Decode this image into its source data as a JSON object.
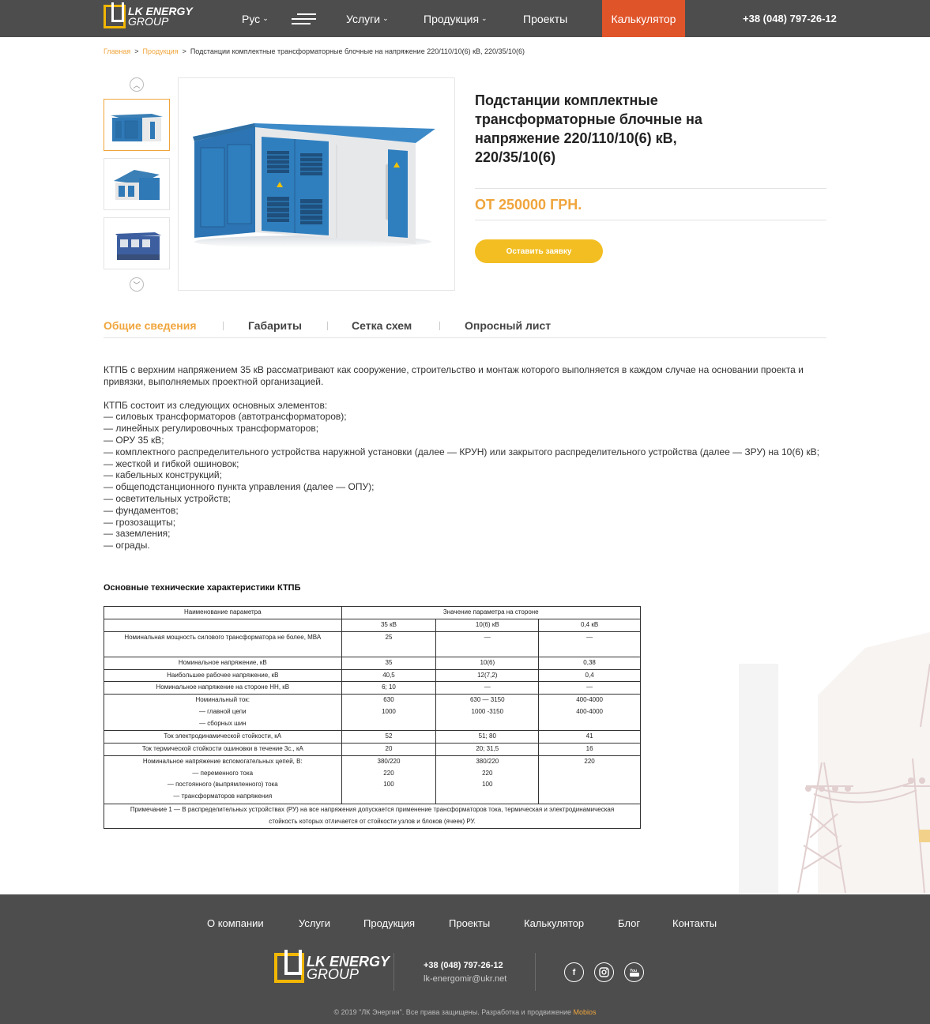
{
  "header": {
    "logo_top": "LK ENERGY",
    "logo_bottom": "GROUP",
    "lang": "Рус",
    "nav_services": "Услуги",
    "nav_products": "Продукция",
    "nav_projects": "Проекты",
    "calculator": "Калькулятор",
    "phone": "+38 (048) 797-26-12"
  },
  "breadcrumb": {
    "home": "Главная",
    "products": "Продукция",
    "current": "Подстанции комплектные трансформаторные блочные на напряжение 220/110/10(6) кВ, 220/35/10(6)",
    "separator": ">"
  },
  "product": {
    "title": "Подстанции комплектные трансформаторные блочные на напряжение 220/110/10(6) кВ, 220/35/10(6)",
    "price": "ОТ 250000 ГРН.",
    "order_button": "Оставить заявку"
  },
  "tabs": [
    "Общие сведения",
    "Габариты",
    "Сетка схем",
    "Опросный лист"
  ],
  "description": {
    "intro": "КТПБ с верхним напряжением 35 кВ  рассматривают как сооружение, строительство и монтаж которого выполняется в каждом случае на основании проекта и привязки, выполняемых проектной организацией.",
    "list_title": "КТПБ состоит из следующих основных элементов:",
    "items": [
      "— силовых трансформаторов (автотрансформаторов);",
      "— линейных регулировочных трансформаторов;",
      "— ОРУ 35 кВ;",
      "— комплектного распределительного устройства наружной установки (далее — КРУН) или закрытого распределительного устройства (далее — ЗРУ) на 10(6) кВ;",
      "— жесткой и гибкой ошиновок;",
      "— кабельных конструкций;",
      "— общеподстанционного пункта управления (далее — ОПУ);",
      "— осветительных устройств;",
      "— фундаментов;",
      "— грозозащиты;",
      "— заземления;",
      "— ограды."
    ]
  },
  "specs": {
    "title": "Основные технические характеристики КТПБ",
    "header_param": "Наименование параметра",
    "header_value": "Значение параметра на стороне",
    "columns": [
      "35 кВ",
      "10(6) кВ",
      "0,4 кВ"
    ],
    "rows": [
      {
        "name": "Номинальная мощность  силового трансформатора не более, МВА",
        "v": [
          "25",
          "—",
          "—"
        ]
      },
      {
        "name": "Номинальное напряжение, кВ",
        "v": [
          "35",
          "10(6)",
          "0,38"
        ]
      },
      {
        "name": "Наибольшее рабочее напряжение, кВ",
        "v": [
          "40,5",
          "12(7,2)",
          "0,4"
        ]
      },
      {
        "name": "Номинальное напряжение на стороне НН, кВ",
        "v": [
          "6; 10",
          "—",
          "—"
        ]
      },
      {
        "name": "Номинальный ток:\n— главной цепи\n— сборных шин",
        "v": [
          "630\n1000",
          "630 — 3150\n1000 -3150",
          "400-4000\n400-4000"
        ]
      },
      {
        "name": "Ток  электродинамической  стойкости,   кА",
        "v": [
          "52",
          "51; 80",
          "41"
        ]
      },
      {
        "name": "Ток термической стойкости ошиновки в течение 3с., кА",
        "v": [
          "20",
          "20; 31,5",
          "16"
        ]
      },
      {
        "name": "Номинальное напряжение вспомогательных цепей, В:\n— переменного тока\n— постоянного (выпрямленного) тока\n— трансформаторов напряжения",
        "v": [
          "380/220\n220\n100",
          "380/220\n220\n100",
          "220"
        ]
      }
    ],
    "note": "Примечание 1 — В распределительных устройствах (РУ) на все напряжения допускается применение трансформаторов тока, термическая и электродинамическая стойкость которых отличается от стойкости узлов и блоков (ячеек) РУ."
  },
  "footer": {
    "nav": [
      "О компании",
      "Услуги",
      "Продукция",
      "Проекты",
      "Калькулятор",
      "Блог",
      "Контакты"
    ],
    "phone": "+38 (048) 797-26-12",
    "email": "lk-energomir@ukr.net",
    "social_icons": [
      "facebook-icon",
      "instagram-icon",
      "youtube-icon"
    ],
    "copyright": "© 2019 \"ЛК Энергия\". Все права защищены. Разработка и продвижение",
    "developer": "Mobios"
  },
  "colors": {
    "header_bg": "#4d4d4d",
    "accent_orange": "#f0a53c",
    "calc_red": "#e0542a",
    "button_yellow": "#f2be22"
  }
}
